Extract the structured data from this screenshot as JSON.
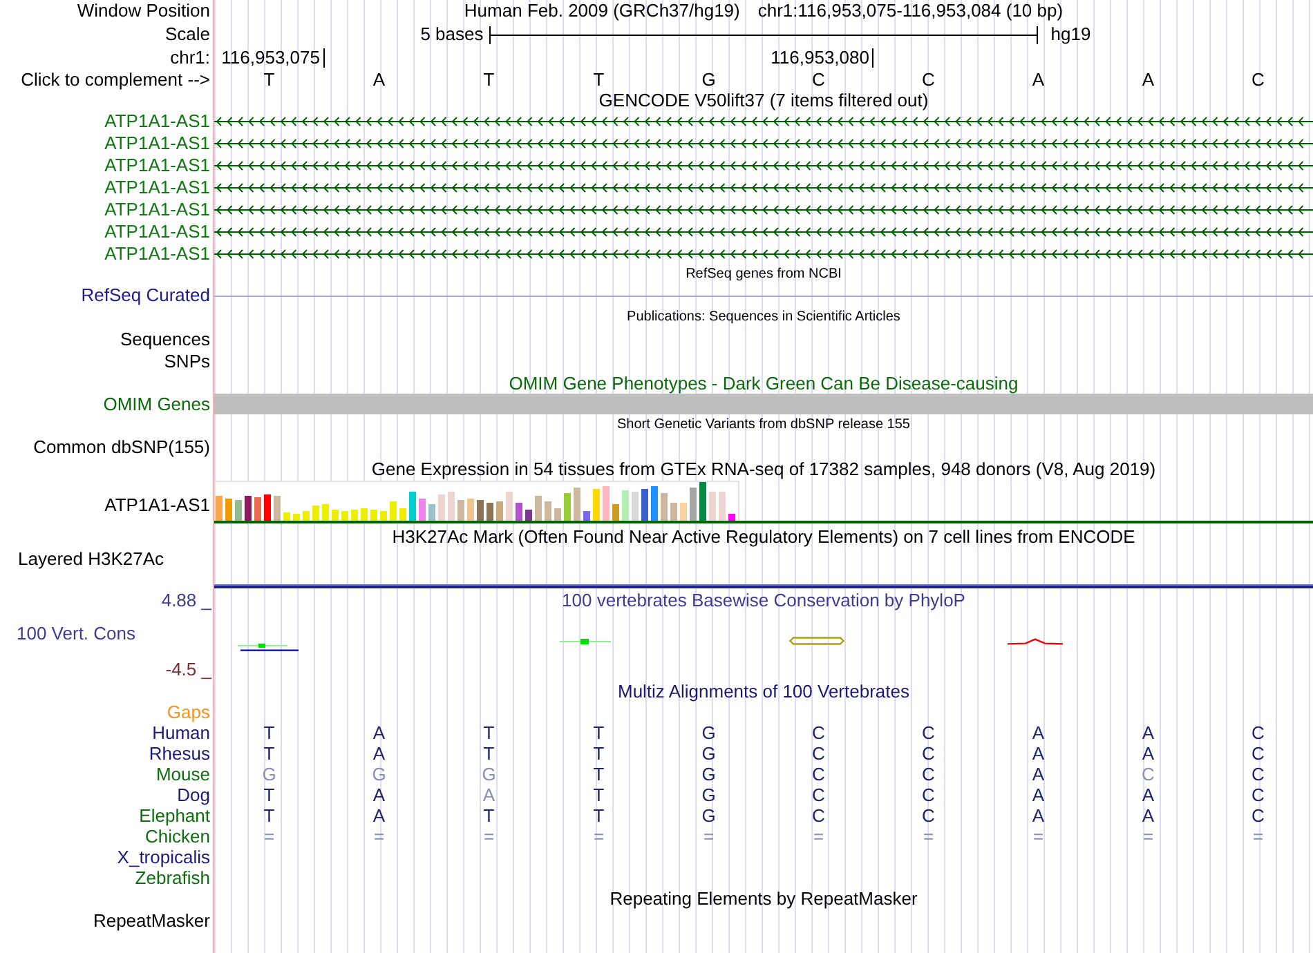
{
  "header": {
    "label": "Window Position",
    "assembly": "Human Feb. 2009 (GRCh37/hg19)",
    "position": "chr1:116,953,075-116,953,084 (10 bp)"
  },
  "scale": {
    "label": "Scale",
    "length": "5 bases",
    "assembly": "hg19"
  },
  "ruler": {
    "label": "chr1:",
    "ticks": [
      "116,953,075",
      "116,953,080"
    ]
  },
  "sequence": {
    "label": "Click to complement -->",
    "bases": [
      "T",
      "A",
      "T",
      "T",
      "G",
      "C",
      "C",
      "A",
      "A",
      "C"
    ]
  },
  "tracks": [
    {
      "kind": "genes",
      "title": "GENCODE V50lift37 (7 items filtered out)",
      "items": [
        {
          "label": "ATP1A1-AS1"
        },
        {
          "label": "ATP1A1-AS1"
        },
        {
          "label": "ATP1A1-AS1"
        },
        {
          "label": "ATP1A1-AS1"
        },
        {
          "label": "ATP1A1-AS1"
        },
        {
          "label": "ATP1A1-AS1"
        },
        {
          "label": "ATP1A1-AS1"
        }
      ]
    },
    {
      "kind": "line",
      "title": "RefSeq genes from NCBI",
      "label": "RefSeq Curated"
    },
    {
      "kind": "dense",
      "title": "Publications: Sequences in Scientific Articles",
      "labels": [
        "Sequences",
        "SNPs"
      ]
    },
    {
      "kind": "bar",
      "title": "OMIM Gene Phenotypes - Dark Green Can Be Disease-causing",
      "label": "OMIM Genes"
    },
    {
      "kind": "dense",
      "title": "Short Genetic Variants from dbSNP release 155",
      "labels": [
        "Common dbSNP(155)"
      ]
    },
    {
      "kind": "expression",
      "title": "Gene Expression in 54 tissues from GTEx RNA-seq of 17382 samples, 948 donors (V8, Aug 2019)",
      "label": "ATP1A1-AS1"
    },
    {
      "kind": "signal",
      "title": "H3K27Ac Mark (Often Found Near Active Regulatory Elements) on 7 cell lines from ENCODE",
      "label": "Layered H3K27Ac"
    },
    {
      "kind": "conservation",
      "title": "100 vertebrates Basewise Conservation by PhyloP",
      "label": "100 Vert. Cons",
      "y_max": "4.88 _",
      "y_min": "-4.5 _"
    },
    {
      "kind": "alignment",
      "title": "Multiz Alignments of 100 Vertebrates",
      "gaps_label": "Gaps",
      "species": [
        {
          "name": "Human",
          "color": "#1a1a7a",
          "bases": [
            "T",
            "A",
            "T",
            "T",
            "G",
            "C",
            "C",
            "A",
            "A",
            "C"
          ]
        },
        {
          "name": "Rhesus",
          "color": "#1a1a7a",
          "bases": [
            "T",
            "A",
            "T",
            "T",
            "G",
            "C",
            "C",
            "A",
            "A",
            "C"
          ]
        },
        {
          "name": "Mouse",
          "color": "#0e6e0e",
          "bases": [
            "G",
            "G",
            "G",
            "T",
            "G",
            "C",
            "C",
            "A",
            "C",
            "C"
          ]
        },
        {
          "name": "Dog",
          "color": "#1a1a7a",
          "bases": [
            "T",
            "A",
            "A",
            "T",
            "G",
            "C",
            "C",
            "A",
            "A",
            "C"
          ]
        },
        {
          "name": "Elephant",
          "color": "#0e6e0e",
          "bases": [
            "T",
            "A",
            "T",
            "T",
            "G",
            "C",
            "C",
            "A",
            "A",
            "C"
          ]
        },
        {
          "name": "Chicken",
          "color": "#0e6e0e",
          "bases": [
            "=",
            "=",
            "=",
            "=",
            "=",
            "=",
            "=",
            "=",
            "=",
            "="
          ]
        },
        {
          "name": "X_tropicalis",
          "color": "#1a1a7a"
        },
        {
          "name": "Zebrafish",
          "color": "#0e6e0e"
        }
      ]
    },
    {
      "kind": "empty",
      "title": "Repeating Elements by RepeatMasker",
      "labels": [
        "RepeatMasker"
      ]
    }
  ]
}
